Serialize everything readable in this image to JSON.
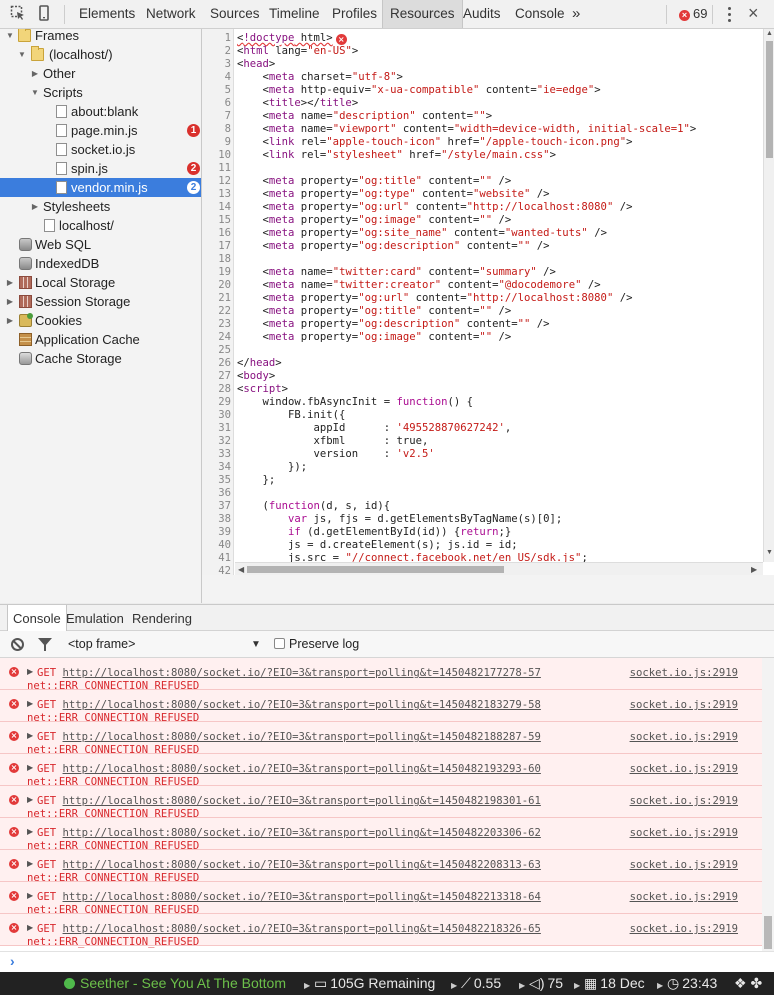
{
  "toolbar": {
    "tabs": [
      "Elements",
      "Network",
      "Sources",
      "Timeline",
      "Profiles",
      "Resources",
      "Audits",
      "Console"
    ],
    "active_tab": "Resources",
    "more": "»",
    "error_count": "69",
    "close": "×"
  },
  "sidebar": {
    "items": [
      {
        "label": "Frames",
        "icon": "folder-icon",
        "expanded": true
      },
      {
        "label": "(localhost/)",
        "icon": "folder-icon",
        "expanded": true
      },
      {
        "label": "Other",
        "expanded": false
      },
      {
        "label": "Scripts",
        "expanded": true
      },
      {
        "label": "about:blank",
        "icon": "file-icon"
      },
      {
        "label": "page.min.js",
        "icon": "file-icon",
        "badge": "1"
      },
      {
        "label": "socket.io.js",
        "icon": "file-icon"
      },
      {
        "label": "spin.js",
        "icon": "file-icon",
        "badge": "2"
      },
      {
        "label": "vendor.min.js",
        "icon": "file-icon",
        "badge": "2",
        "selected": true
      },
      {
        "label": "Stylesheets",
        "expanded": false
      },
      {
        "label": "localhost/",
        "icon": "file-icon"
      },
      {
        "label": "Web SQL",
        "icon": "database-icon"
      },
      {
        "label": "IndexedDB",
        "icon": "database-icon"
      },
      {
        "label": "Local Storage",
        "icon": "storage-grid-icon",
        "expanded": false
      },
      {
        "label": "Session Storage",
        "icon": "storage-grid-icon",
        "expanded": false
      },
      {
        "label": "Cookies",
        "icon": "cookie-icon",
        "expanded": false
      },
      {
        "label": "Application Cache",
        "icon": "app-cache-icon"
      },
      {
        "label": "Cache Storage",
        "icon": "cache-storage-icon"
      }
    ]
  },
  "editor": {
    "lines": [
      "<!doctype html>",
      "<html lang=\"en-US\">",
      "<head>",
      "    <meta charset=\"utf-8\">",
      "    <meta http-equiv=\"x-ua-compatible\" content=\"ie=edge\">",
      "    <title></title>",
      "    <meta name=\"description\" content=\"\">",
      "    <meta name=\"viewport\" content=\"width=device-width, initial-scale=1\">",
      "    <link rel=\"apple-touch-icon\" href=\"/apple-touch-icon.png\">",
      "    <link rel=\"stylesheet\" href=\"/style/main.css\">",
      "",
      "    <meta property=\"og:title\" content=\"\" />",
      "    <meta property=\"og:type\" content=\"website\" />",
      "    <meta property=\"og:url\" content=\"http://localhost:8080\" />",
      "    <meta property=\"og:image\" content=\"\" />",
      "    <meta property=\"og:site_name\" content=\"wanted-tuts\" />",
      "    <meta property=\"og:description\" content=\"\" />",
      "",
      "    <meta name=\"twitter:card\" content=\"summary\" />",
      "    <meta name=\"twitter:creator\" content=\"@docodemore\" />",
      "    <meta property=\"og:url\" content=\"http://localhost:8080\" />",
      "    <meta property=\"og:title\" content=\"\" />",
      "    <meta property=\"og:description\" content=\"\" />",
      "    <meta property=\"og:image\" content=\"\" />",
      "",
      "</head>",
      "<body>",
      "<script>",
      "    window.fbAsyncInit = function() {",
      "        FB.init({",
      "            appId      : '495528870627242',",
      "            xfbml      : true,",
      "            version    : 'v2.5'",
      "        });",
      "    };",
      "",
      "    (function(d, s, id){",
      "        var js, fjs = d.getElementsByTagName(s)[0];",
      "        if (d.getElementById(id)) {return;}",
      "        js = d.createElement(s); js.id = id;",
      "        js.src = \"//connect.facebook.net/en_US/sdk.js\";",
      ""
    ],
    "line_numbers": [
      "1",
      "2",
      "3",
      "4",
      "5",
      "6",
      "7",
      "8",
      "9",
      "10",
      "11",
      "12",
      "13",
      "14",
      "15",
      "16",
      "17",
      "18",
      "19",
      "20",
      "21",
      "22",
      "23",
      "24",
      "25",
      "26",
      "27",
      "28",
      "29",
      "30",
      "31",
      "32",
      "33",
      "34",
      "35",
      "36",
      "37",
      "38",
      "39",
      "40",
      "41",
      "42"
    ]
  },
  "drawer": {
    "tabs": [
      "Console",
      "Emulation",
      "Rendering"
    ],
    "active_tab": "Console",
    "frame_select": "<top frame>",
    "preserve_log": "Preserve log",
    "preserve_checked": false
  },
  "console": {
    "messages": [
      {
        "method": "GET",
        "url": "http://localhost:8080/socket.io/?EIO=3&transport=polling&t=1450482177278-57",
        "error": "net::ERR_CONNECTION_REFUSED",
        "source": "socket.io.js:2919"
      },
      {
        "method": "GET",
        "url": "http://localhost:8080/socket.io/?EIO=3&transport=polling&t=1450482183279-58",
        "error": "net::ERR_CONNECTION_REFUSED",
        "source": "socket.io.js:2919"
      },
      {
        "method": "GET",
        "url": "http://localhost:8080/socket.io/?EIO=3&transport=polling&t=1450482188287-59",
        "error": "net::ERR_CONNECTION_REFUSED",
        "source": "socket.io.js:2919"
      },
      {
        "method": "GET",
        "url": "http://localhost:8080/socket.io/?EIO=3&transport=polling&t=1450482193293-60",
        "error": "net::ERR_CONNECTION_REFUSED",
        "source": "socket.io.js:2919"
      },
      {
        "method": "GET",
        "url": "http://localhost:8080/socket.io/?EIO=3&transport=polling&t=1450482198301-61",
        "error": "net::ERR_CONNECTION_REFUSED",
        "source": "socket.io.js:2919"
      },
      {
        "method": "GET",
        "url": "http://localhost:8080/socket.io/?EIO=3&transport=polling&t=1450482203306-62",
        "error": "net::ERR_CONNECTION_REFUSED",
        "source": "socket.io.js:2919"
      },
      {
        "method": "GET",
        "url": "http://localhost:8080/socket.io/?EIO=3&transport=polling&t=1450482208313-63",
        "error": "net::ERR_CONNECTION_REFUSED",
        "source": "socket.io.js:2919"
      },
      {
        "method": "GET",
        "url": "http://localhost:8080/socket.io/?EIO=3&transport=polling&t=1450482213318-64",
        "error": "net::ERR_CONNECTION_REFUSED",
        "source": "socket.io.js:2919"
      },
      {
        "method": "GET",
        "url": "http://localhost:8080/socket.io/?EIO=3&transport=polling&t=1450482218326-65",
        "error": "net::ERR_CONNECTION_REFUSED",
        "source": "socket.io.js:2919"
      }
    ],
    "prompt": "›"
  },
  "statusbar": {
    "music": "Seether - See You At The Bottom",
    "disk": "105G Remaining",
    "load": "0.55",
    "volume": "75",
    "date": "18 Dec",
    "time": "23:43"
  },
  "colors": {
    "accent": "#3b7ddd",
    "error": "#e23a3a",
    "error_bg": "#fff0f0",
    "music_green": "#6cc04a"
  }
}
